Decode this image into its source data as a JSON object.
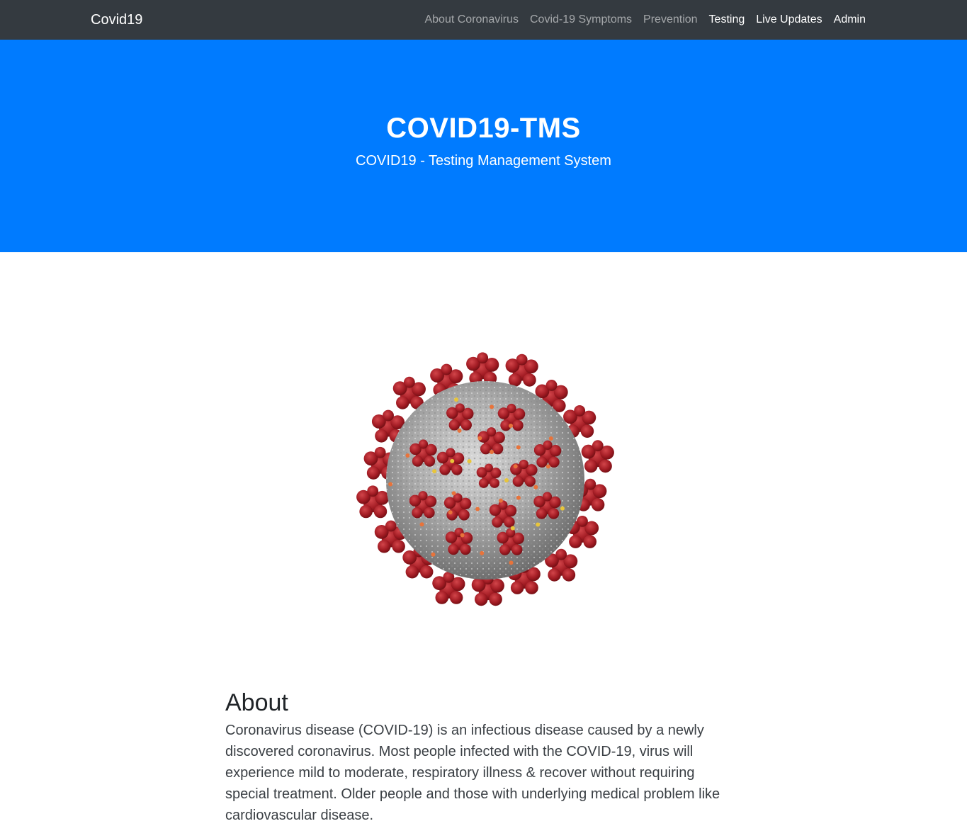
{
  "navbar": {
    "brand": "Covid19",
    "links": [
      {
        "label": "About Coronavirus",
        "active": false
      },
      {
        "label": "Covid-19 Symptoms",
        "active": false
      },
      {
        "label": "Prevention",
        "active": false
      },
      {
        "label": "Testing",
        "active": true
      },
      {
        "label": "Live Updates",
        "active": true
      },
      {
        "label": "Admin",
        "active": true
      }
    ]
  },
  "hero": {
    "title": "COVID19-TMS",
    "subtitle": "COVID19 - Testing Management System",
    "background": "#007bff"
  },
  "image": {
    "name": "coronavirus-illustration"
  },
  "about": {
    "title": "About",
    "text": "Coronavirus disease (COVID-19) is an infectious disease caused by a newly discovered coronavirus. Most people infected with the COVID-19, virus will experience mild to moderate, respiratory illness & recover without requiring special treatment. Older people and those with underlying medical problem like cardiovascular disease."
  }
}
